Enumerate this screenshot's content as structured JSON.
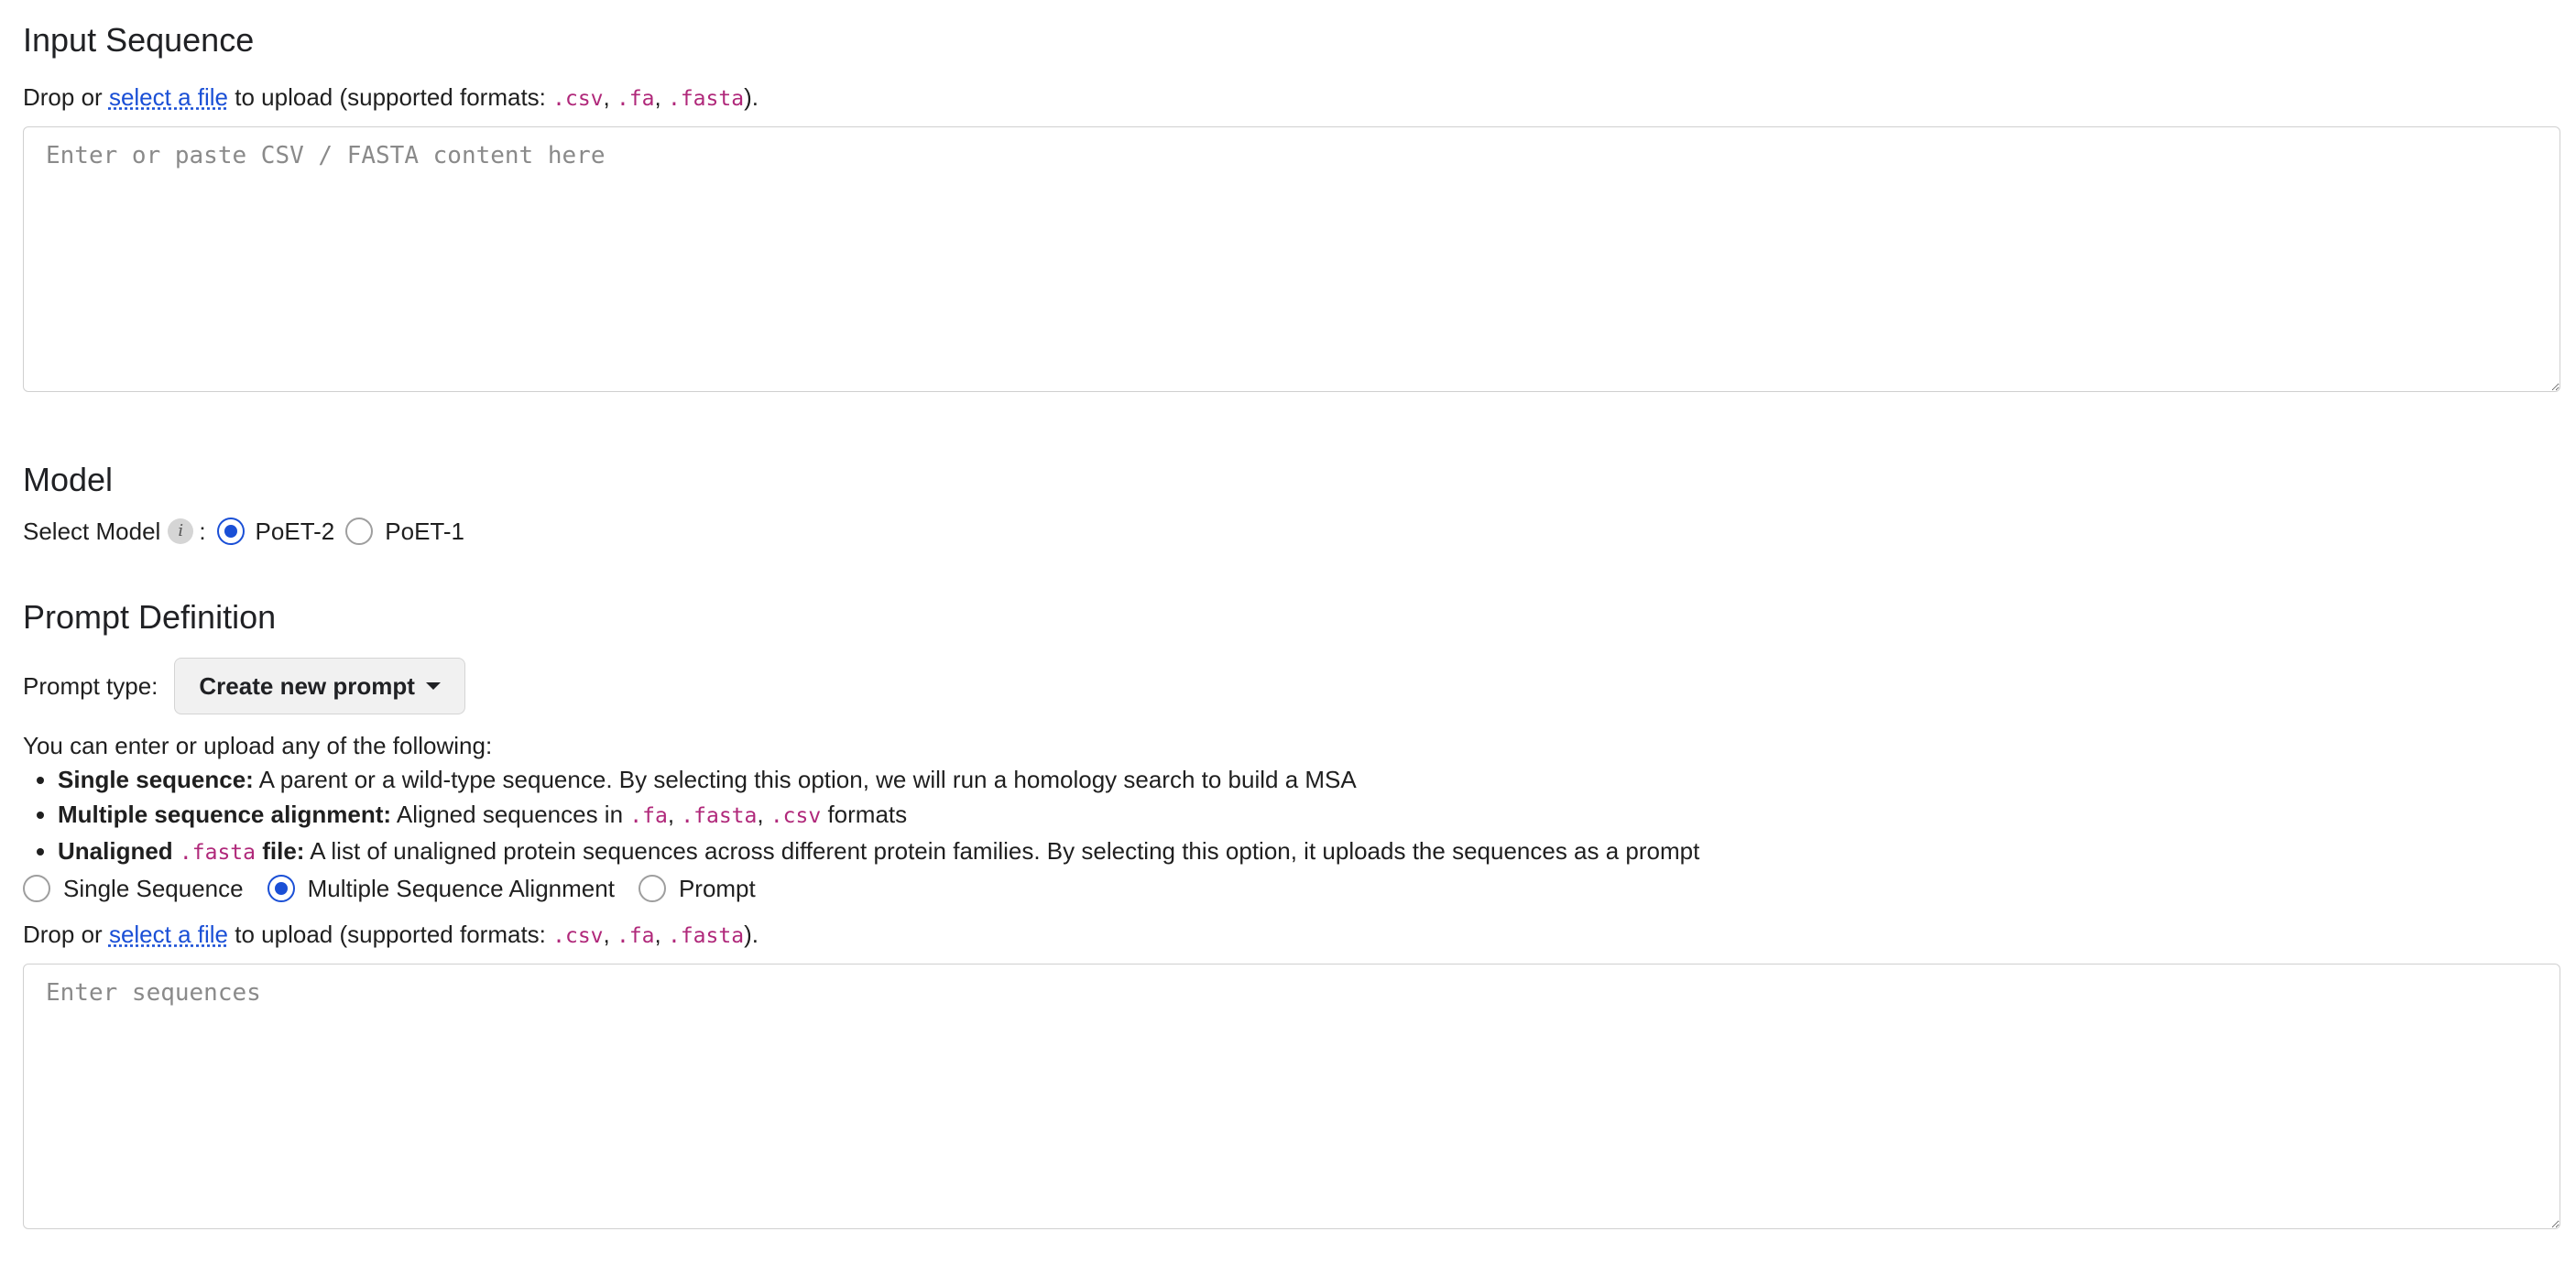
{
  "input_section": {
    "title": "Input Sequence",
    "upload_prefix": "Drop or",
    "upload_link": "select a file",
    "upload_middle": "to upload (supported formats:",
    "fmt_csv": ".csv",
    "fmt_fa": ".fa",
    "fmt_fasta": ".fasta",
    "upload_suffix": ").",
    "placeholder": "Enter or paste CSV / FASTA content here"
  },
  "model_section": {
    "title": "Model",
    "select_label": "Select Model",
    "info_glyph": "i",
    "colon": ":",
    "options": [
      {
        "label": "PoET-2",
        "selected": true
      },
      {
        "label": "PoET-1",
        "selected": false
      }
    ]
  },
  "prompt_section": {
    "title": "Prompt Definition",
    "prompt_type_label": "Prompt type:",
    "prompt_type_value": "Create new prompt",
    "intro": "You can enter or upload any of the following:",
    "bullets": {
      "single_bold": "Single sequence:",
      "single_text": "A parent or a wild-type sequence. By selecting this option, we will run a homology search to build a MSA",
      "msa_bold": "Multiple sequence alignment:",
      "msa_text": "Aligned sequences in",
      "msa_fa": ".fa",
      "msa_fasta": ".fasta",
      "msa_csv": ".csv",
      "msa_suffix": "formats",
      "unaligned_bold1": "Unaligned",
      "unaligned_code": ".fasta",
      "unaligned_bold2": "file:",
      "unaligned_text": "A list of unaligned protein sequences across different protein families. By selecting this option, it uploads the sequences as a prompt"
    },
    "type_options": [
      {
        "label": "Single Sequence",
        "selected": false
      },
      {
        "label": "Multiple Sequence Alignment",
        "selected": true
      },
      {
        "label": "Prompt",
        "selected": false
      }
    ],
    "upload_prefix": "Drop or",
    "upload_link": "select a file",
    "upload_middle": "to upload (supported formats:",
    "fmt_csv": ".csv",
    "fmt_fa": ".fa",
    "fmt_fasta": ".fasta",
    "upload_suffix": ").",
    "placeholder": "Enter sequences"
  },
  "colors": {
    "accent": "#1a4fd6",
    "code": "#b0287a",
    "border": "#d0d0d0"
  }
}
